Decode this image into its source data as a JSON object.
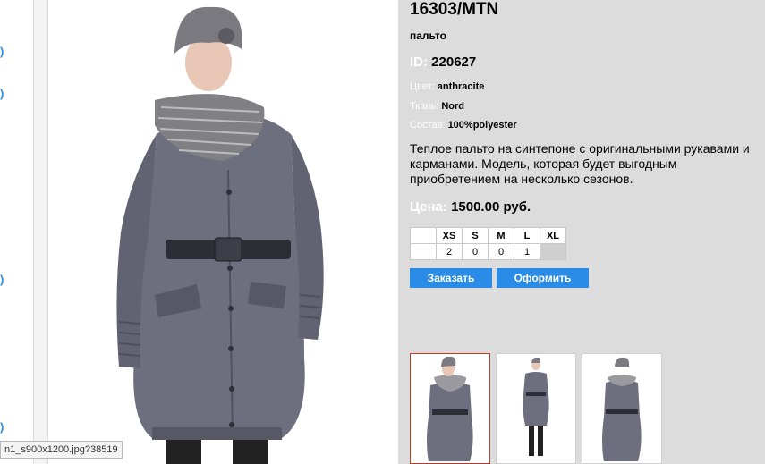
{
  "sidebar": {
    "markers": [
      ")",
      ")",
      ")",
      ")"
    ]
  },
  "product": {
    "title": "16303/MTN",
    "subtitle": "пальто",
    "id_label": "ID:",
    "id_value": "220627",
    "color_label": "Цвет:",
    "color_value": "anthracite",
    "fabric_label": "Ткань:",
    "fabric_value": "Nord",
    "composition_label": "Состав:",
    "composition_value": "100%polyester",
    "description": "Теплое пальто на синтепоне с оригинальными рукавами и карманами.  Модель, которая будет выгодным приобретением на несколько сезонов.",
    "price_label": "Цена:",
    "price_value": "1500.00 руб."
  },
  "sizes": {
    "headers": [
      "XS",
      "S",
      "M",
      "L",
      "XL"
    ],
    "quantities": [
      "2",
      "0",
      "0",
      "1",
      ""
    ]
  },
  "buttons": {
    "order": "Заказать",
    "checkout": "Оформить"
  },
  "status_bar": {
    "url": "n1_s900x1200.jpg?38519"
  },
  "colors": {
    "accent": "#2a8ce6",
    "panel": "#dcdcdc",
    "coat": "#6e6f7e",
    "active_thumb_border": "#c0392b"
  }
}
